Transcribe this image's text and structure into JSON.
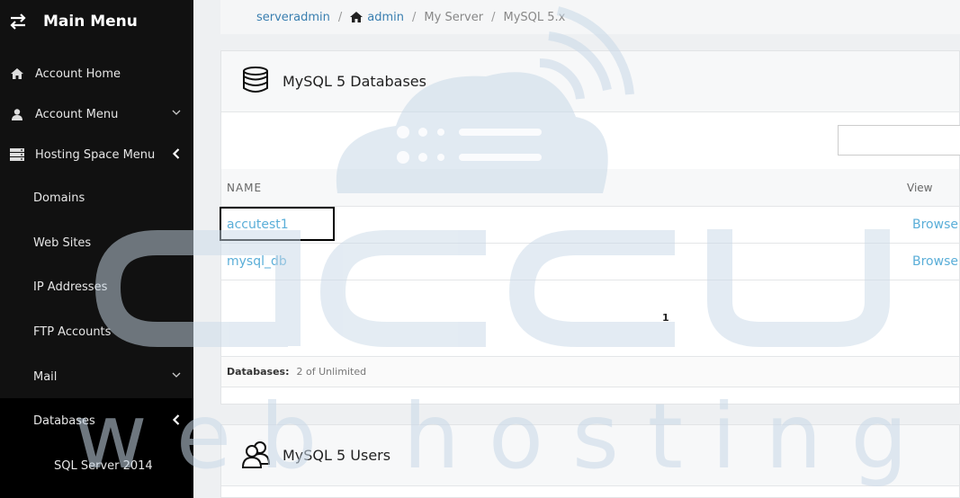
{
  "sidebar": {
    "title": "Main Menu",
    "items": [
      {
        "label": "Account Home",
        "icon": "home-icon"
      },
      {
        "label": "Account Menu",
        "icon": "user-icon"
      },
      {
        "label": "Hosting Space Menu",
        "icon": "server-icon"
      },
      {
        "label": "Domains"
      },
      {
        "label": "Web Sites"
      },
      {
        "label": "IP Addresses"
      },
      {
        "label": "FTP Accounts"
      },
      {
        "label": "Mail"
      },
      {
        "label": "Databases"
      },
      {
        "label": "SQL Server 2014"
      }
    ]
  },
  "breadcrumb": {
    "serveradmin": "serveradmin",
    "admin": "admin",
    "server": "My Server",
    "current": "MySQL 5.x"
  },
  "databases_card": {
    "title": "MySQL 5 Databases",
    "col_name": "NAME",
    "col_view": "View",
    "rows": [
      {
        "name": "accutest1",
        "action": "Browse"
      },
      {
        "name": "mysql_db",
        "action": "Browse"
      }
    ],
    "page": "1",
    "footer_label": "Databases:",
    "footer_value": "2 of Unlimited"
  },
  "users_card": {
    "title": "MySQL 5 Users"
  },
  "watermark": {
    "line2": "w e b   h o s t i n g"
  },
  "colors": {
    "sidebar_bg": "#111111",
    "link": "#5aaed8",
    "watermark": "#c9d9e8"
  }
}
